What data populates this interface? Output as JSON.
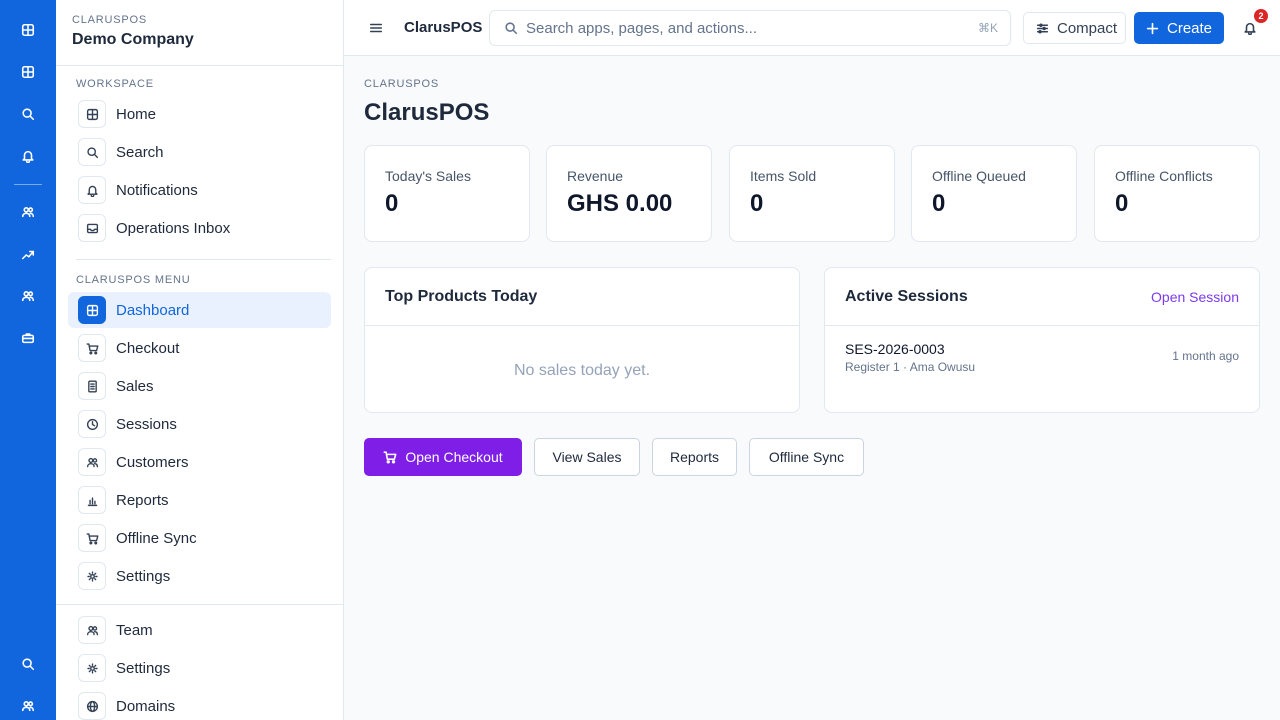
{
  "rail": {
    "icons": [
      "grid-icon",
      "grid-icon",
      "search-icon",
      "bell-icon",
      "users-icon",
      "trending-up-icon",
      "users-icon",
      "briefcase-icon",
      "search-icon",
      "users-icon"
    ]
  },
  "sidebar": {
    "kicker": "CLARUSPOS",
    "company": "Demo Company",
    "workspace_label": "WORKSPACE",
    "workspace_items": [
      {
        "label": "Home",
        "icon": "grid-icon"
      },
      {
        "label": "Search",
        "icon": "search-icon"
      },
      {
        "label": "Notifications",
        "icon": "bell-icon"
      },
      {
        "label": "Operations Inbox",
        "icon": "inbox-icon"
      }
    ],
    "menu_label": "CLARUSPOS MENU",
    "menu_items": [
      {
        "label": "Dashboard",
        "icon": "grid-icon",
        "active": true
      },
      {
        "label": "Checkout",
        "icon": "cart-icon"
      },
      {
        "label": "Sales",
        "icon": "receipt-icon"
      },
      {
        "label": "Sessions",
        "icon": "clock-icon"
      },
      {
        "label": "Customers",
        "icon": "users-icon"
      },
      {
        "label": "Reports",
        "icon": "bar-chart-icon"
      },
      {
        "label": "Offline Sync",
        "icon": "cart-icon"
      },
      {
        "label": "Settings",
        "icon": "gear-icon"
      }
    ],
    "bottom_items": [
      {
        "label": "Team",
        "icon": "users-icon"
      },
      {
        "label": "Settings",
        "icon": "gear-icon"
      },
      {
        "label": "Domains",
        "icon": "globe-icon"
      }
    ]
  },
  "topbar": {
    "app_title": "ClarusPOS",
    "search_placeholder": "Search apps, pages, and actions...",
    "search_shortcut": "⌘K",
    "compact_label": "Compact",
    "create_label": "Create",
    "notification_count": "2"
  },
  "main": {
    "breadcrumb": "CLARUSPOS",
    "title": "ClarusPOS",
    "stats": [
      {
        "label": "Today's Sales",
        "value": "0"
      },
      {
        "label": "Revenue",
        "value": "GHS 0.00"
      },
      {
        "label": "Items Sold",
        "value": "0"
      },
      {
        "label": "Offline Queued",
        "value": "0"
      },
      {
        "label": "Offline Conflicts",
        "value": "0"
      }
    ],
    "top_products": {
      "title": "Top Products Today",
      "empty_text": "No sales today yet."
    },
    "active_sessions": {
      "title": "Active Sessions",
      "link_label": "Open Session",
      "sessions": [
        {
          "id": "SES-2026-0003",
          "detail": "Register 1 · Ama Owusu",
          "time": "1 month ago"
        }
      ]
    },
    "actions": {
      "open_checkout": "Open Checkout",
      "view_sales": "View Sales",
      "reports": "Reports",
      "offline_sync": "Offline Sync"
    }
  },
  "colors": {
    "brand_blue": "#1266dd",
    "accent_purple": "#7e1ee6",
    "badge_red": "#dc2626"
  }
}
